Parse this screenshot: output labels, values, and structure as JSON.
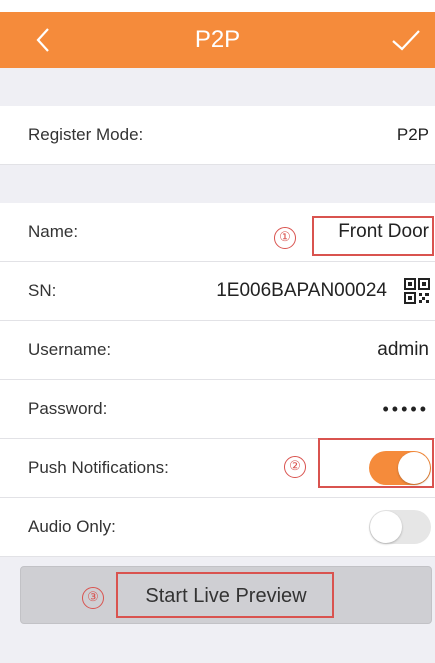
{
  "header": {
    "title": "P2P",
    "back_icon": "chevron-left-icon",
    "done_icon": "checkmark-icon",
    "color": "#f58b3b"
  },
  "register_mode": {
    "label": "Register Mode:",
    "value": "P2P"
  },
  "fields": {
    "name": {
      "label": "Name:",
      "value": "Front Door"
    },
    "sn": {
      "label": "SN:",
      "value": "1E006BAPAN00024",
      "icon": "qr-code-icon"
    },
    "username": {
      "label": "Username:",
      "value": "admin"
    },
    "password": {
      "label": "Password:",
      "value": "•••••"
    },
    "push_notifications": {
      "label": "Push Notifications:",
      "state": "on"
    },
    "audio_only": {
      "label": "Audio Only:",
      "state": "off"
    }
  },
  "action": {
    "label": "Start Live Preview"
  },
  "annotations": {
    "one": "①",
    "two": "②",
    "three": "③",
    "color": "#d9534f"
  }
}
